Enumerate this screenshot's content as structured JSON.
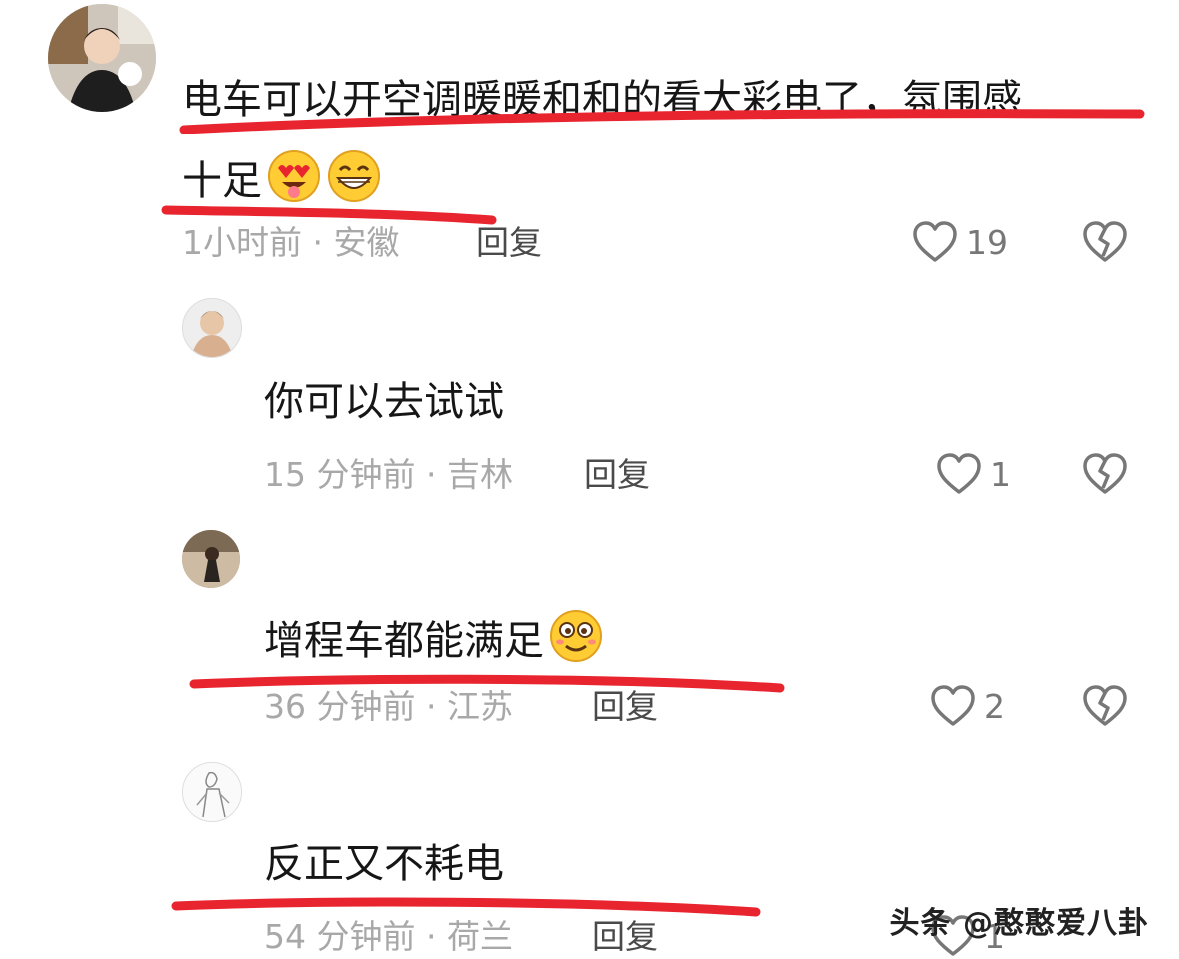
{
  "comments": [
    {
      "text_line1": "电车可以开空调暖暖和和的看大彩电了，氛围感",
      "text_line2": "十足",
      "time": "1小时前",
      "location": "安徽",
      "reply": "回复",
      "likes": "19",
      "emojis": [
        "heart-eyes-tongue-emoji",
        "grin-emoji"
      ]
    },
    {
      "text": "你可以去试试",
      "time": "15 分钟前",
      "location": "吉林",
      "reply": "回复",
      "likes": "1"
    },
    {
      "text": "增程车都能满足",
      "time": "36 分钟前",
      "location": "江苏",
      "reply": "回复",
      "likes": "2",
      "emojis": [
        "silly-emoji"
      ]
    },
    {
      "text": "反正又不耗电",
      "time": "54 分钟前",
      "location": "荷兰",
      "reply": "回复",
      "likes": "1"
    }
  ],
  "separator": " · ",
  "watermark": "头条 @憨憨爱八卦",
  "colors": {
    "underline": "#e8242f",
    "text": "#161616",
    "meta": "#a8a8a8"
  }
}
